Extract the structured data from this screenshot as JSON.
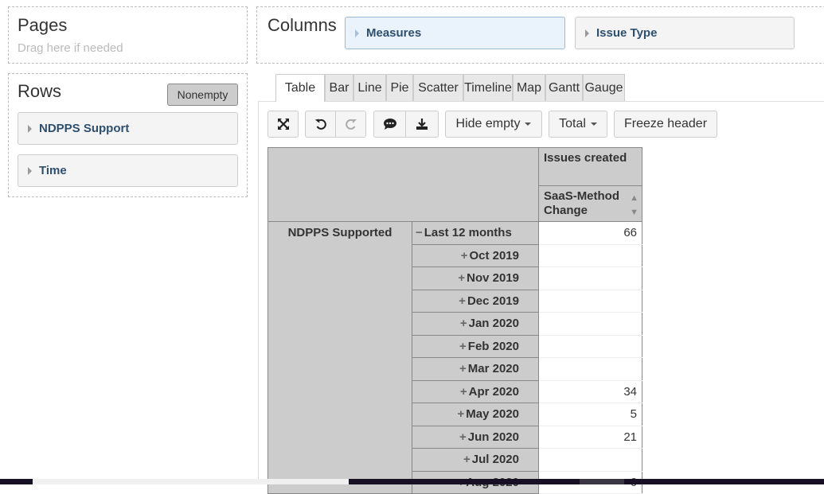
{
  "pages": {
    "title": "Pages",
    "placeholder": "Drag here if needed"
  },
  "rows": {
    "title": "Rows",
    "nonempty_label": "Nonempty",
    "items": [
      {
        "label": "NDPPS Support"
      },
      {
        "label": "Time"
      }
    ]
  },
  "columns": {
    "title": "Columns",
    "items": [
      {
        "label": "Measures",
        "active": true
      },
      {
        "label": "Issue Type",
        "active": false
      }
    ]
  },
  "tabs": [
    {
      "label": "Table",
      "active": true
    },
    {
      "label": "Bar"
    },
    {
      "label": "Line"
    },
    {
      "label": "Pie"
    },
    {
      "label": "Scatter"
    },
    {
      "label": "Timeline"
    },
    {
      "label": "Map"
    },
    {
      "label": "Gantt"
    },
    {
      "label": "Gauge"
    }
  ],
  "toolbar": {
    "icons": {
      "fullscreen": "expand-arrows-icon",
      "undo": "undo-icon",
      "redo": "redo-icon",
      "comment": "comment-icon",
      "export": "download-icon"
    },
    "hide_empty": "Hide empty",
    "total": "Total",
    "freeze_header": "Freeze header"
  },
  "table": {
    "measure_header": "Issues created",
    "column_header": "SaaS-Method Change",
    "row_dimension": "NDPPS Supported",
    "rows": [
      {
        "label": "Last 12 months",
        "expanded": true,
        "value": "66"
      },
      {
        "label": "Oct 2019",
        "value": ""
      },
      {
        "label": "Nov 2019",
        "value": ""
      },
      {
        "label": "Dec 2019",
        "value": ""
      },
      {
        "label": "Jan 2020",
        "value": ""
      },
      {
        "label": "Feb 2020",
        "value": ""
      },
      {
        "label": "Mar 2020",
        "value": ""
      },
      {
        "label": "Apr 2020",
        "value": "34"
      },
      {
        "label": "May 2020",
        "value": "5"
      },
      {
        "label": "Jun 2020",
        "value": "21"
      },
      {
        "label": "Jul 2020",
        "value": ""
      },
      {
        "label": "Aug 2020",
        "value": "6"
      }
    ]
  }
}
